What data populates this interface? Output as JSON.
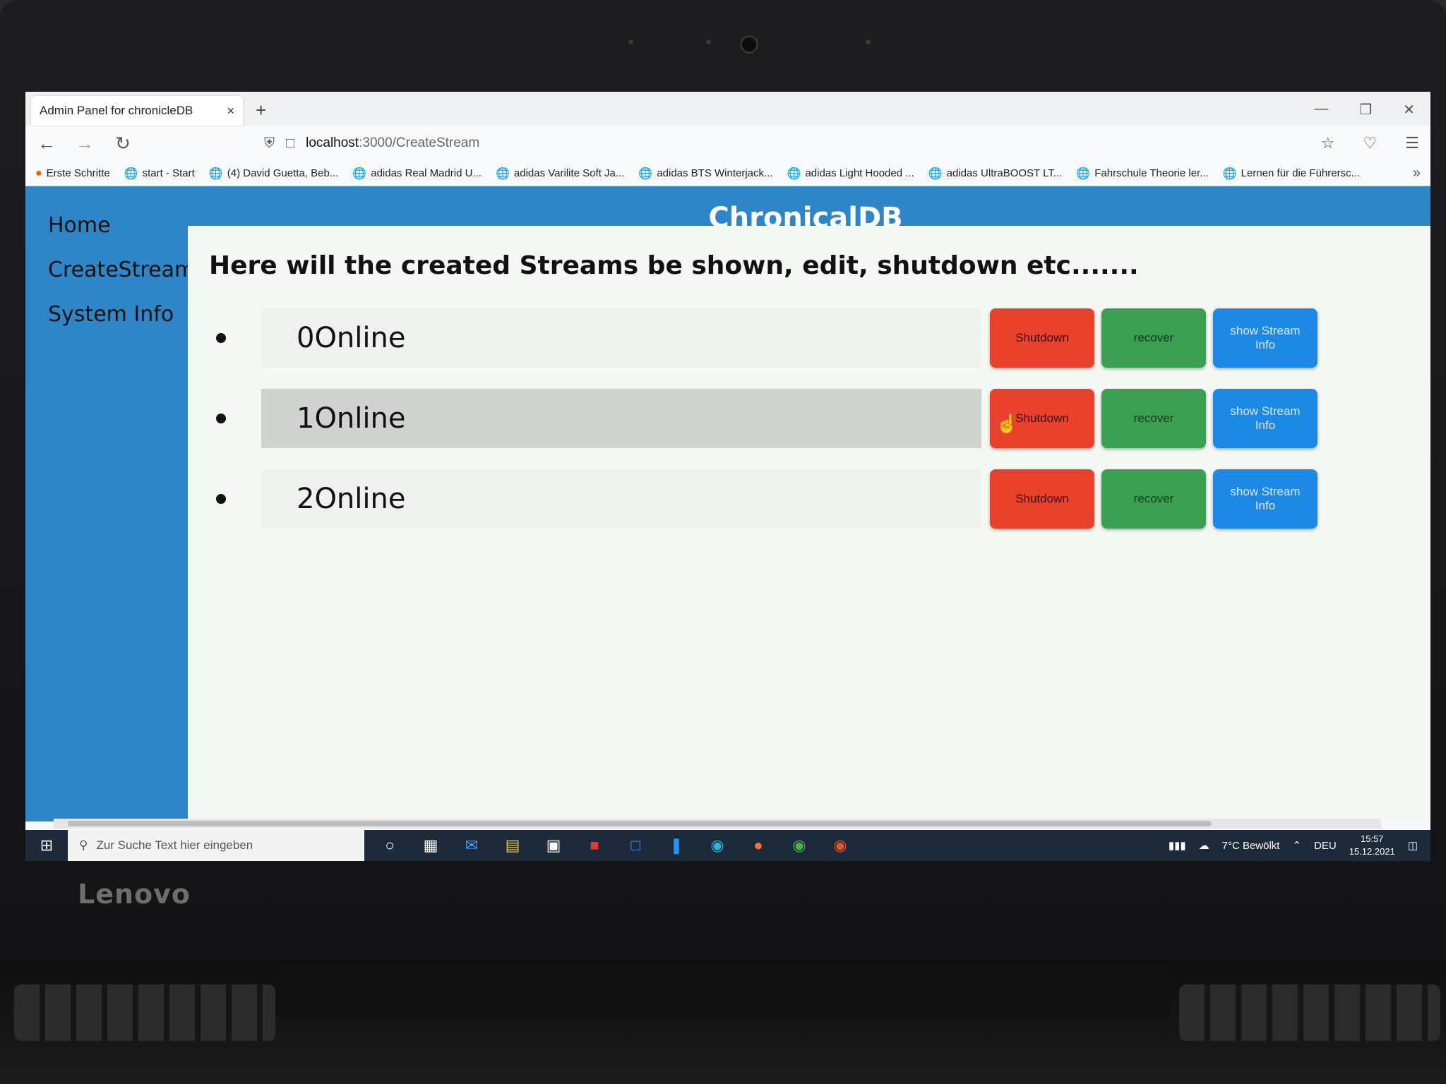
{
  "browser": {
    "tab_title": "Admin Panel for chronicleDB",
    "tab_close": "×",
    "new_tab": "+",
    "url_host": "localhost",
    "url_path": ":3000/CreateStream",
    "bookmarks": [
      "Erste Schritte",
      "start - Start",
      "(4) David Guetta, Beb...",
      "adidas Real Madrid U...",
      "adidas Varilite Soft Ja...",
      "adidas BTS Winterjack...",
      "adidas Light Hooded ...",
      "adidas UltraBOOST LT...",
      "Fahrschule Theorie ler...",
      "Lernen für die Führersc..."
    ]
  },
  "app": {
    "brand": "ChronicalDB",
    "nav": [
      "Home",
      "CreateStream",
      "System Info"
    ],
    "heading": "Here will the created Streams be shown, edit, shutdown etc.......",
    "streams": [
      {
        "name": "0Online",
        "hovered": false
      },
      {
        "name": "1Online",
        "hovered": true
      },
      {
        "name": "2Online",
        "hovered": false
      }
    ],
    "buttons": {
      "shutdown": "Shutdown",
      "recover": "recover",
      "info": "show Stream Info"
    },
    "colors": {
      "primary": "#2e86c8",
      "shutdown": "#e8412c",
      "recover": "#3a9e53",
      "info": "#1e88e5"
    }
  },
  "taskbar": {
    "search_placeholder": "Zur Suche Text hier eingeben",
    "weather": "7°C  Bewölkt",
    "language": "DEU",
    "time": "15:57",
    "date": "15.12.2021"
  },
  "laptop": {
    "brand": "Lenovo"
  }
}
